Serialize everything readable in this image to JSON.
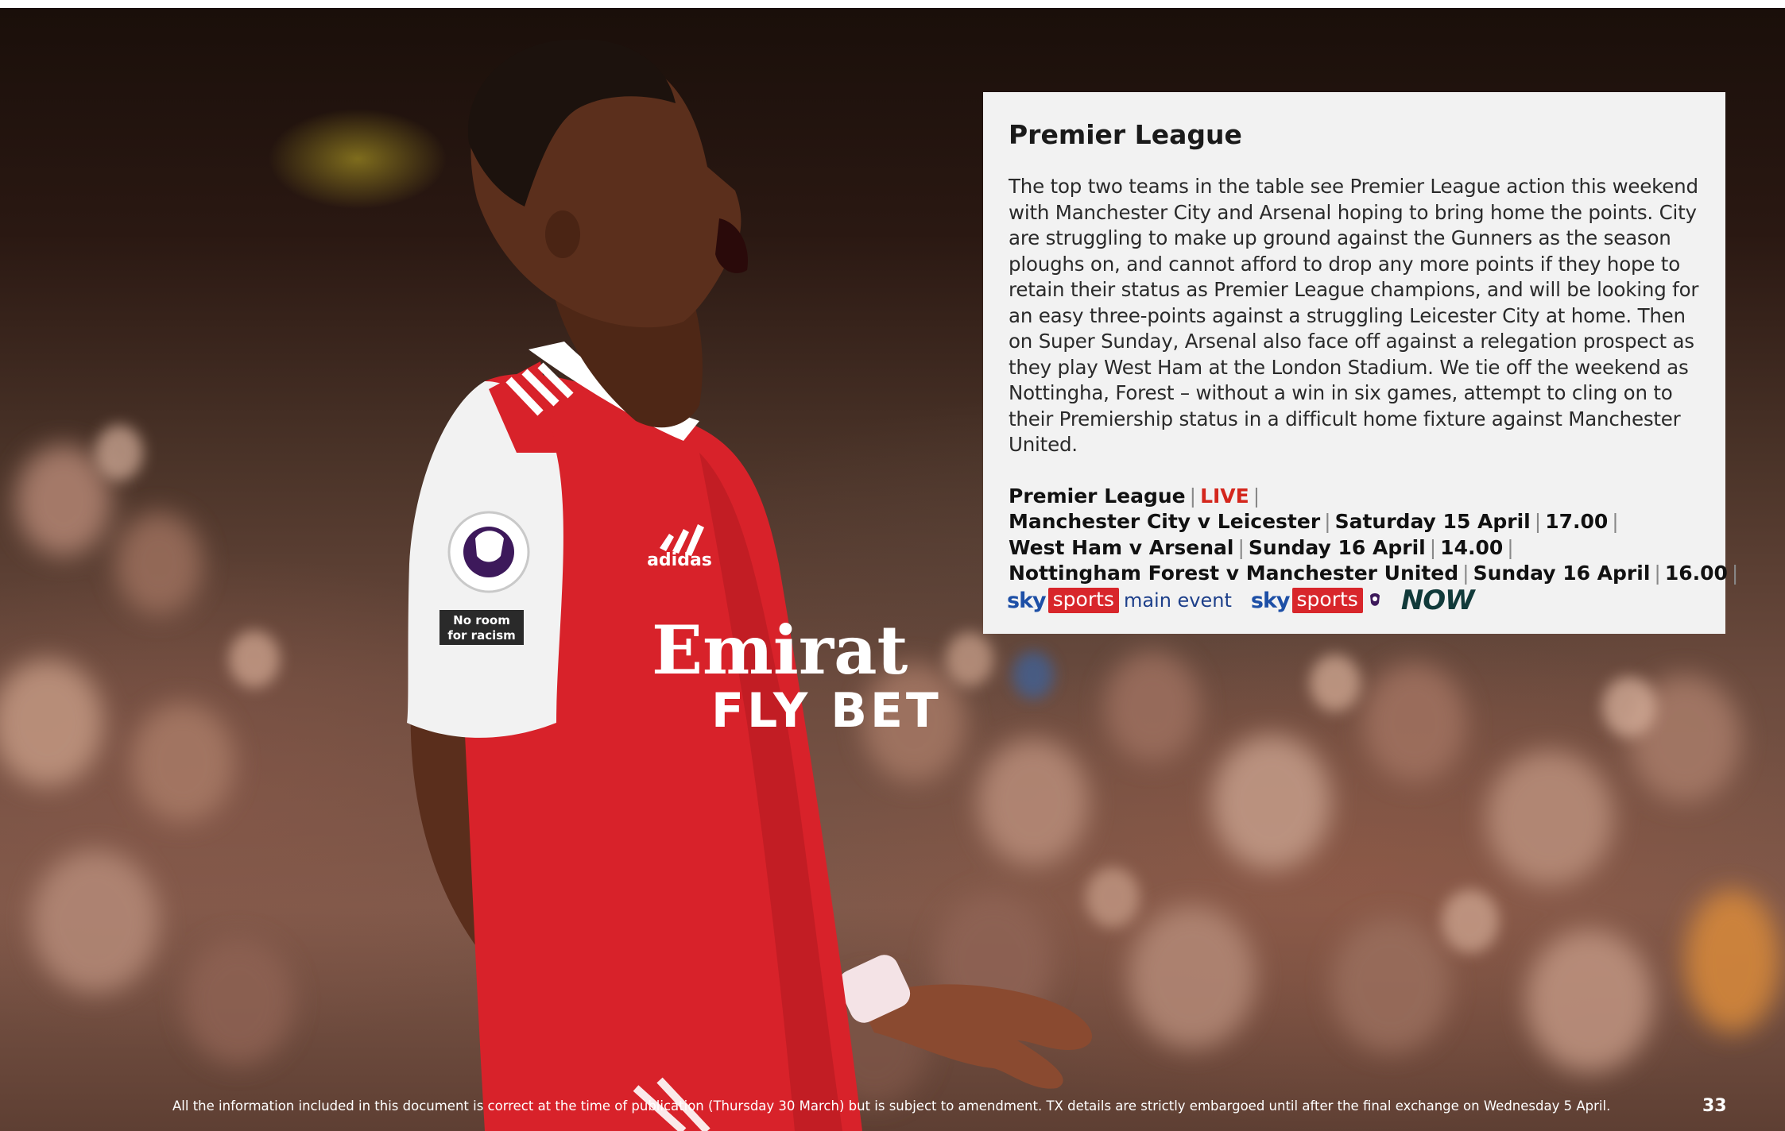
{
  "article": {
    "title": "Premier League",
    "body": "The top two teams in the table see Premier League action this weekend with Manchester City and Arsenal hoping to bring home the points. City are struggling to make up ground against the Gunners as the season ploughs on, and cannot afford to drop any more points if they hope to retain their status as Premier League champions, and will be looking for an easy three-points against a struggling Leicester City at home. Then on Super Sunday, Arsenal also face off against a relegation prospect as they play West Ham at the London Stadium. We tie off the weekend as Nottingha, Forest – without a win in six games, attempt to cling on to their Premiership status in a difficult home fixture against Manchester United."
  },
  "schedule": {
    "header": {
      "competition": "Premier League",
      "status": "LIVE"
    },
    "fixtures": [
      {
        "match": "Manchester City v Leicester",
        "date": "Saturday 15 April",
        "time": "17.00"
      },
      {
        "match": "West Ham v Arsenal",
        "date": "Sunday 16 April",
        "time": "14.00"
      },
      {
        "match": "Nottingham Forest v Manchester United",
        "date": "Sunday 16 April",
        "time": "16.00"
      }
    ]
  },
  "channels": [
    {
      "brand": "sky",
      "product": "sports",
      "suffix": "main event"
    },
    {
      "brand": "sky",
      "product": "sports",
      "suffix": ""
    },
    {
      "brand": "NOW"
    }
  ],
  "player_shirt": {
    "sponsor_line1": "Emirat",
    "sponsor_line2": "FLY BET",
    "kit_brand": "adidas",
    "badge_text": "No room for racism",
    "league_patch": "Premier League"
  },
  "footer": {
    "note": "All the information included in this document is correct at the time of publication (Thursday 30 March) but is subject to amendment. TX details are strictly embargoed until after the final exchange on Wednesday 5 April.",
    "page_number": "33"
  },
  "colors": {
    "live": "#d4261c",
    "sky_blue": "#1d4fa6",
    "sky_sports_red": "#d8262b",
    "now_dark": "#113a3a",
    "box_background": "#f2f2f2",
    "shirt_red": "#d8222a"
  },
  "icons": [
    "premier-league-lion-icon",
    "adidas-logo-icon"
  ]
}
